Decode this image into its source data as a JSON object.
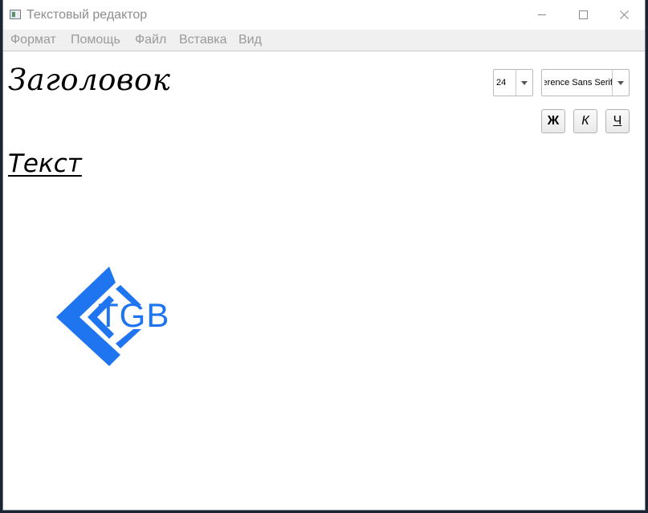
{
  "window": {
    "title": "Текстовый редактор"
  },
  "menu": {
    "items": [
      "Формат",
      "Помощь",
      "Файл",
      "Вставка",
      "Вид"
    ]
  },
  "toolbar": {
    "font_size": "24",
    "font_name": "Reference Sans Serif",
    "bold_label": "Ж",
    "italic_label": "К",
    "underline_label": "Ч"
  },
  "document": {
    "heading": "Заголовок",
    "text": "Текст",
    "logo_text": "TGB"
  },
  "colors": {
    "logo": "#1f74f0"
  },
  "icons": {
    "app": "app-window-icon",
    "minimize": "minimize-icon",
    "maximize": "maximize-icon",
    "close": "close-icon",
    "dropdown": "chevron-down-icon"
  }
}
